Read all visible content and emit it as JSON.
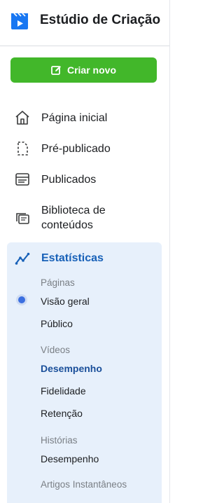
{
  "app": {
    "title": "Estúdio de Criação",
    "logo_icon": "clapperboard-play-icon",
    "accent": "#1861b8"
  },
  "create_button": {
    "label": "Criar novo",
    "icon": "edit-square-icon",
    "color": "#42b72a"
  },
  "nav": {
    "home": {
      "label": "Página inicial",
      "icon": "home-icon"
    },
    "pre_published": {
      "label": "Pré-publicado",
      "icon": "dashed-document-icon"
    },
    "published": {
      "label": "Publicados",
      "icon": "window-icon"
    },
    "library": {
      "label": "Biblioteca de conteúdos",
      "label_line1": "Biblioteca de",
      "label_line2": "conteúdos",
      "icon": "stacked-cards-icon"
    },
    "stats": {
      "label": "Estatísticas",
      "icon": "trend-line-icon",
      "sections": {
        "pages": {
          "title": "Páginas",
          "items": [
            "Visão geral",
            "Público"
          ],
          "selected": "Visão geral"
        },
        "videos": {
          "title": "Vídeos",
          "items": [
            "Desempenho",
            "Fidelidade",
            "Retenção"
          ],
          "active": "Desempenho"
        },
        "stories": {
          "title": "Histórias",
          "items": [
            "Desempenho"
          ]
        },
        "instant_articles": {
          "title": "Artigos Instantâneos"
        }
      }
    }
  }
}
